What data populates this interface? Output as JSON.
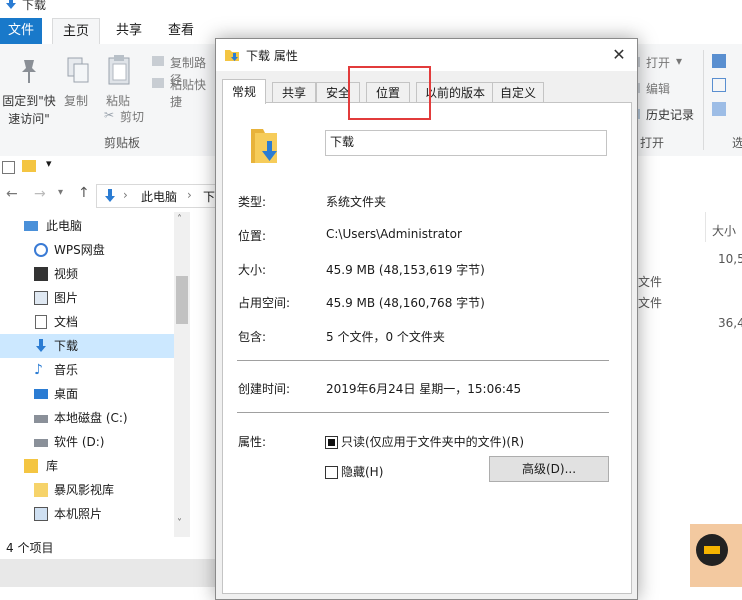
{
  "explorer": {
    "window_title": "下载",
    "ribbon_tabs": [
      "文件",
      "主页",
      "共享",
      "查看"
    ],
    "ribbon": {
      "pin_label_line1": "固定到\"快",
      "pin_label_line2": "速访问\"",
      "copy": "复制",
      "paste": "粘贴",
      "copy_path": "复制路径",
      "paste_shortcut": "粘贴快捷",
      "cut": "剪切",
      "group_clipboard": "剪贴板",
      "open": "打开",
      "edit": "编辑",
      "history": "历史记录",
      "group_open": "打开",
      "group_right_partial": "选"
    },
    "breadcrumb": [
      "此电脑",
      "下"
    ],
    "nav_items": [
      {
        "label": "此电脑",
        "icon": "pc-icon"
      },
      {
        "label": "WPS网盘",
        "icon": "cloud-icon"
      },
      {
        "label": "视频",
        "icon": "video-icon"
      },
      {
        "label": "图片",
        "icon": "picture-icon"
      },
      {
        "label": "文档",
        "icon": "document-icon"
      },
      {
        "label": "下载",
        "icon": "download-icon"
      },
      {
        "label": "音乐",
        "icon": "music-icon"
      },
      {
        "label": "桌面",
        "icon": "desktop-icon"
      },
      {
        "label": "本地磁盘 (C:)",
        "icon": "drive-icon"
      },
      {
        "label": "软件 (D:)",
        "icon": "drive-icon"
      },
      {
        "label": "库",
        "icon": "library-icon"
      },
      {
        "label": "暴风影视库",
        "icon": "folder-icon"
      },
      {
        "label": "本机照片",
        "icon": "photo-icon"
      }
    ],
    "status": "4 个项目",
    "right_column": {
      "header": "大小",
      "cells": [
        "10,5",
        "36,4"
      ],
      "partial_texts": [
        "文件",
        "文件"
      ]
    }
  },
  "dialog": {
    "title": "下载 属性",
    "tabs": [
      "常规",
      "共享",
      "安全",
      "位置",
      "以前的版本",
      "自定义"
    ],
    "folder_name": "下载",
    "type_label": "类型:",
    "type_value": "系统文件夹",
    "location_label": "位置:",
    "location_value": "C:\\Users\\Administrator",
    "size_label": "大小:",
    "size_value": "45.9 MB (48,153,619 字节)",
    "disk_label": "占用空间:",
    "disk_value": "45.9 MB (48,160,768 字节)",
    "contains_label": "包含:",
    "contains_value": "5 个文件，0 个文件夹",
    "created_label": "创建时间:",
    "created_value": "2019年6月24日 星期一，15:06:45",
    "attr_label": "属性:",
    "readonly_label": "只读(仅应用于文件夹中的文件)(R)",
    "readonly_checked": true,
    "hidden_label": "隐藏(H)",
    "hidden_checked": false,
    "advanced_button": "高级(D)..."
  },
  "colors": {
    "accent": "#1979ca",
    "selection": "#cce8ff",
    "highlight_box": "#e23b3b",
    "folder_yellow": "#f4c542",
    "download_blue": "#2b7cd3"
  }
}
